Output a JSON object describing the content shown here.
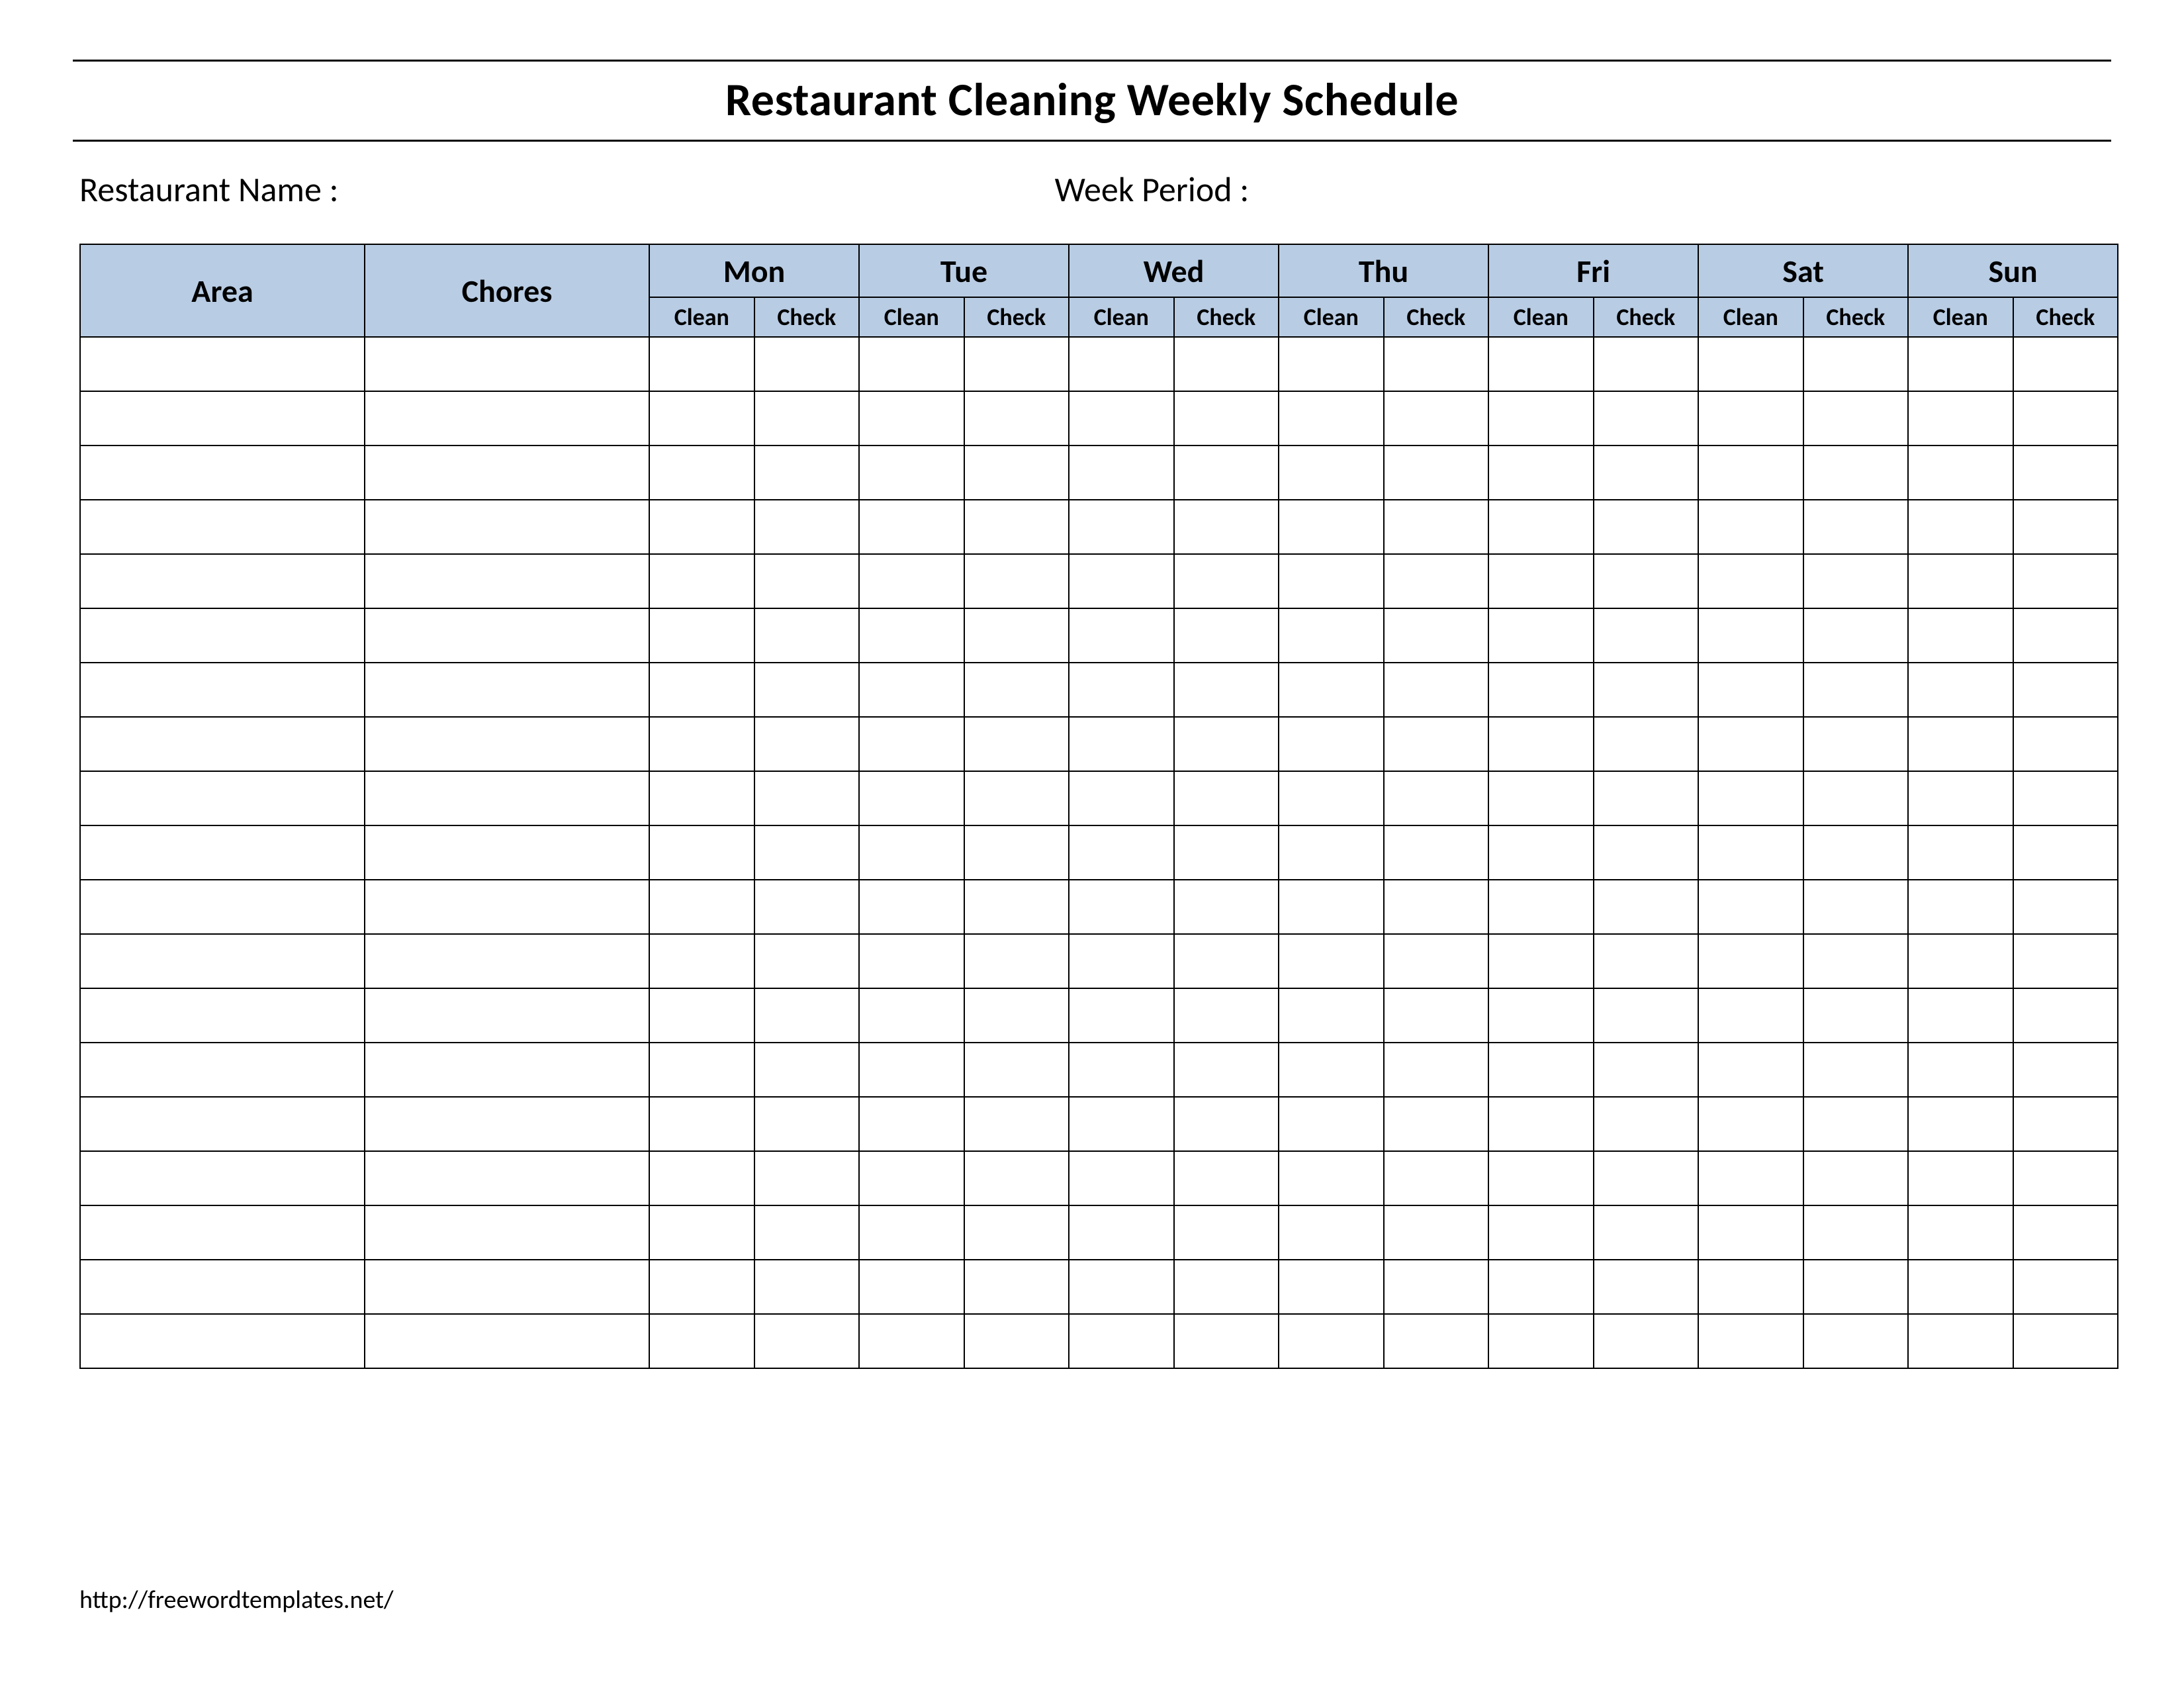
{
  "title": "Restaurant Cleaning Weekly Schedule",
  "meta": {
    "restaurant_name_label": "Restaurant Name   :",
    "week_period_label": "Week  Period :"
  },
  "columns": {
    "area": "Area",
    "chores": "Chores",
    "days": [
      "Mon",
      "Tue",
      "Wed",
      "Thu",
      "Fri",
      "Sat",
      "Sun"
    ],
    "sub": {
      "clean": "Clean",
      "check": "Check"
    }
  },
  "body_row_count": 19,
  "footer_url": "http://freewordtemplates.net/"
}
